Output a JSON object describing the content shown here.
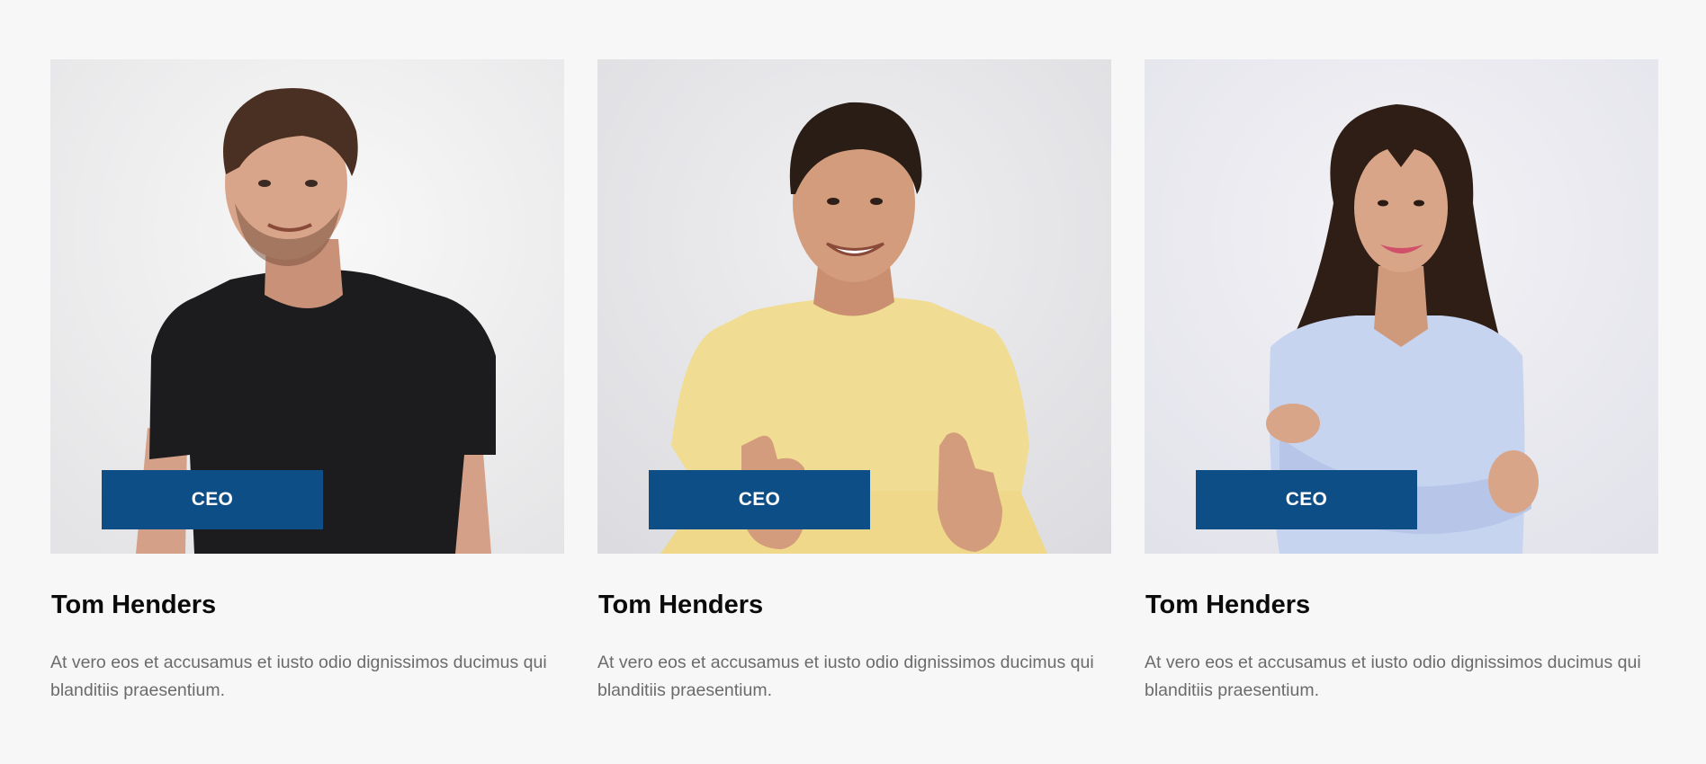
{
  "team": [
    {
      "role": "CEO",
      "name": "Tom Henders",
      "description": "At vero eos et accusamus et iusto odio dignissimos ducimus qui blanditiis praesentium.",
      "photo": "man-black-tshirt-photo",
      "colors": {
        "background": "#eeeeee",
        "shirt": "#1c1c1e",
        "skin": "#d8a58a",
        "hair": "#4a3022"
      }
    },
    {
      "role": "CEO",
      "name": "Tom Henders",
      "description": "At vero eos et accusamus et iusto odio dignissimos ducimus qui blanditiis praesentium.",
      "photo": "man-yellow-tshirt-thumbs-up-photo",
      "colors": {
        "background": "#e5e5e8",
        "shirt": "#f0dc92",
        "skin": "#d39c7c",
        "hair": "#2a1d16"
      }
    },
    {
      "role": "CEO",
      "name": "Tom Henders",
      "description": "At vero eos et accusamus et iusto odio dignissimos ducimus qui blanditiis praesentium.",
      "photo": "woman-blue-shirt-arms-crossed-photo",
      "colors": {
        "background": "#e8e8ef",
        "shirt": "#c7d4f0",
        "skin": "#d9a588",
        "hair": "#2e1e16"
      }
    }
  ],
  "colors": {
    "page_background": "#f7f7f7",
    "badge": "#0e4e86",
    "name_text": "#0b0b0b",
    "description_text": "#6b6b6b"
  }
}
